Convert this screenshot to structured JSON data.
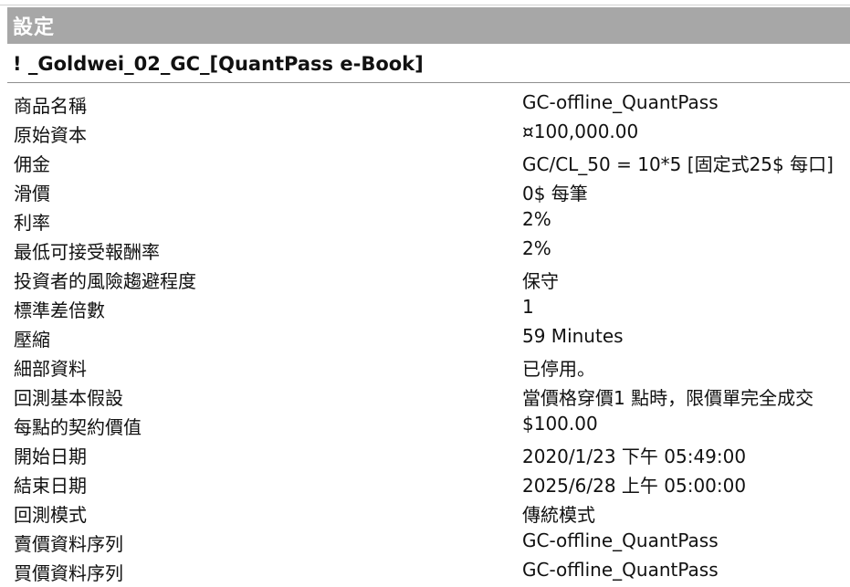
{
  "header": {
    "title": "設定"
  },
  "strategy": {
    "name": "! _Goldwei_02_GC_[QuantPass e-Book]"
  },
  "settings": [
    {
      "label": "商品名稱",
      "value": "GC-offline_QuantPass"
    },
    {
      "label": "原始資本",
      "value": "¤100,000.00"
    },
    {
      "label": "佣金",
      "value": "GC/CL_50 = 10*5 [固定式25$ 每口]"
    },
    {
      "label": "滑價",
      "value": "0$ 每筆"
    },
    {
      "label": "利率",
      "value": "2%"
    },
    {
      "label": "最低可接受報酬率",
      "value": "2%"
    },
    {
      "label": "投資者的風險趨避程度",
      "value": "保守"
    },
    {
      "label": "標準差倍數",
      "value": "1"
    },
    {
      "label": "壓縮",
      "value": "59 Minutes"
    },
    {
      "label": "細部資料",
      "value": "已停用。"
    },
    {
      "label": "回測基本假設",
      "value": "當價格穿價1 點時，限價單完全成交"
    },
    {
      "label": "每點的契約價值",
      "value": "$100.00"
    },
    {
      "label": "開始日期",
      "value": "2020/1/23 下午 05:49:00"
    },
    {
      "label": "結束日期",
      "value": "2025/6/28 上午 05:00:00"
    },
    {
      "label": "回測模式",
      "value": "傳統模式"
    },
    {
      "label": "賣價資料序列",
      "value": "GC-offline_QuantPass"
    },
    {
      "label": "買價資料序列",
      "value": "GC-offline_QuantPass"
    }
  ]
}
